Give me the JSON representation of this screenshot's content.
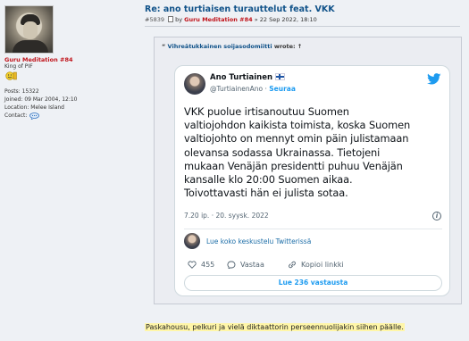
{
  "user": {
    "name": "Guru Meditation #84",
    "rank": "King of PIF",
    "stats": {
      "posts": "Posts: 15322",
      "joined": "Joined: 09 Mar 2004, 12:10",
      "location": "Location: Melee Island",
      "contact": "Contact:"
    },
    "rank_icon": "smiley-badge-icon",
    "contact_icon": "speech-bubble-icon"
  },
  "post": {
    "title": "Re: ano turtiaisen turauttelut feat. VKK",
    "number": "#5839",
    "by": "by",
    "author": "Guru Meditation #84",
    "date": "» 22 Sep 2022, 18:10"
  },
  "quote": {
    "prefix": "“",
    "author": "Vihreätukkainen soijasodomiitti",
    "suffix": "wrote: ↑"
  },
  "tweet": {
    "name": "Ano Turtiainen",
    "handle": "@TurtiainenAno",
    "dot": "·",
    "follow": "Seuraa",
    "text_lines": [
      "VKK puolue irtisanoutuu Suomen",
      "valtiojohdon kaikista toimista, koska Suomen",
      "valtiojohto on mennyt omin päin julistamaan",
      "olevansa sodassa Ukrainassa. Tietojeni",
      "mukaan Venäjän presidentti puhuu Venäjän",
      "kansalle klo 20:00 Suomen aikaa.",
      "Toivottavasti hän ei julista sotaa."
    ],
    "time": "7.20 ip. · 20. syysk. 2022",
    "info": "i",
    "thread_link": "Lue koko keskustelu Twitterissä",
    "likes": "455",
    "reply": "Vastaa",
    "copy": "Kopioi linkki",
    "replies_button": "Lue 236 vastausta"
  },
  "closing_text": "Paskahousu, pelkuri ja vielä diktaattorin perseennuolijakin siihen päälle.",
  "colors": {
    "link": "#105289",
    "author": "#c0141b",
    "twitter_blue": "#1d9bf0",
    "highlight": "#fff6a8"
  }
}
